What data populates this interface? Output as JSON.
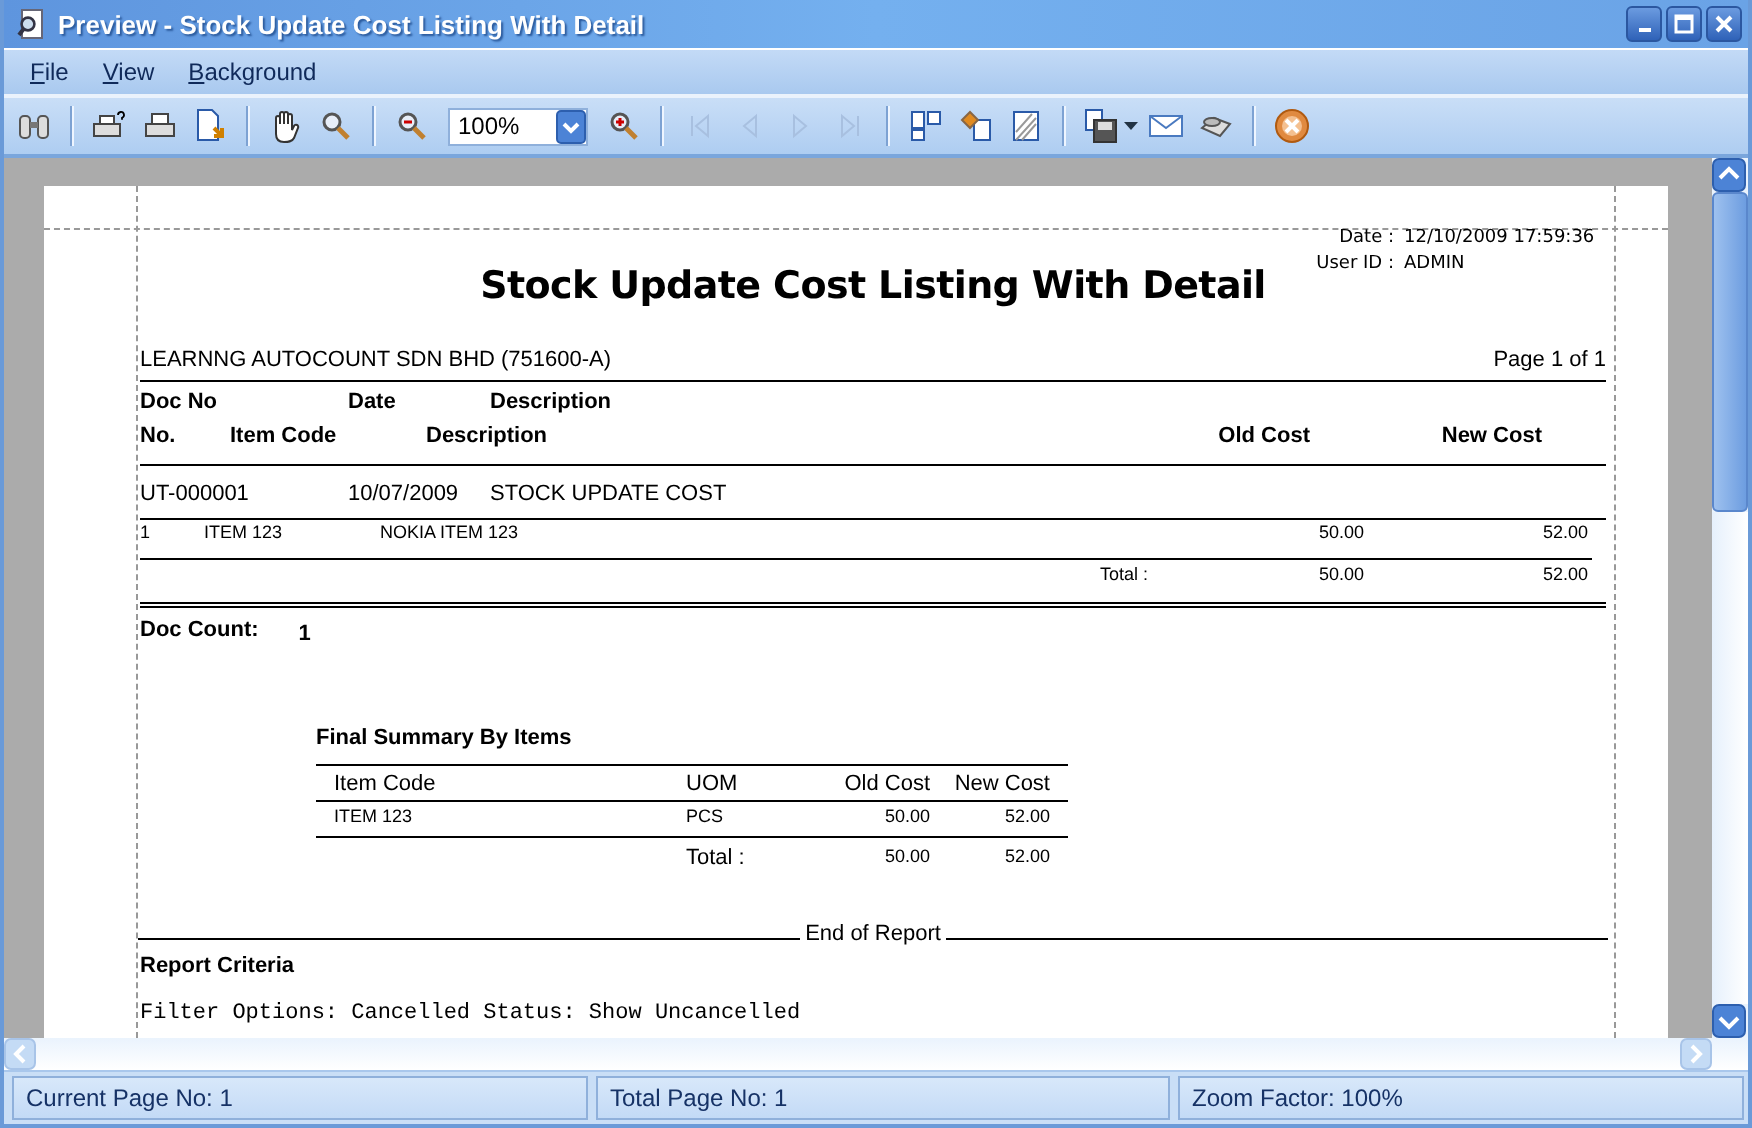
{
  "window": {
    "title": "Preview - Stock Update Cost Listing With Detail"
  },
  "menu": [
    {
      "label": "File"
    },
    {
      "label": "View"
    },
    {
      "label": "Background"
    }
  ],
  "toolbar": {
    "zoom": "100%",
    "navigation": [
      {
        "disabled": true
      },
      {
        "disabled": true
      },
      {
        "disabled": true
      },
      {
        "disabled": true
      }
    ]
  },
  "report": {
    "date_label": "Date :",
    "date": "12/10/2009 17:59:36",
    "user_label": "User ID :",
    "user": "ADMIN",
    "title": "Stock Update Cost Listing With Detail",
    "company": "LEARNNG AUTOCOUNT SDN BHD (751600-A)",
    "page": "Page 1 of 1",
    "header_row_1": [
      "Doc No",
      "Date",
      "Description"
    ],
    "header_row_2": [
      "No.",
      "Item Code",
      "Description",
      "Old Cost",
      "New Cost"
    ],
    "documents": [
      {
        "doc_no": "UT-000001",
        "date": "10/07/2009",
        "description": "STOCK UPDATE COST",
        "total_label": "Total :",
        "total_old": "50.00",
        "total_new": "52.00",
        "lines": [
          {
            "no": "1",
            "item_code": "ITEM 123",
            "description": "NOKIA ITEM 123",
            "old_cost": "50.00",
            "new_cost": "52.00"
          }
        ]
      }
    ],
    "doc_count_label": "Doc Count:",
    "doc_count": "1",
    "summary": {
      "title": "Final Summary By Items",
      "columns": [
        "Item Code",
        "UOM",
        "Old Cost",
        "New Cost"
      ],
      "rows": [
        [
          "ITEM 123",
          "PCS",
          "50.00",
          "52.00"
        ]
      ],
      "total_label": "Total :",
      "total_old": "50.00",
      "total_new": "52.00"
    },
    "end_label": "End of Report",
    "criteria_title": "Report Criteria",
    "criteria_lines": [
      "Filter Options: Cancelled Status: Show Uncancelled"
    ]
  },
  "status_bar": [
    "Current Page No: 1",
    "Total Page No: 1",
    "Zoom Factor: 100%"
  ]
}
